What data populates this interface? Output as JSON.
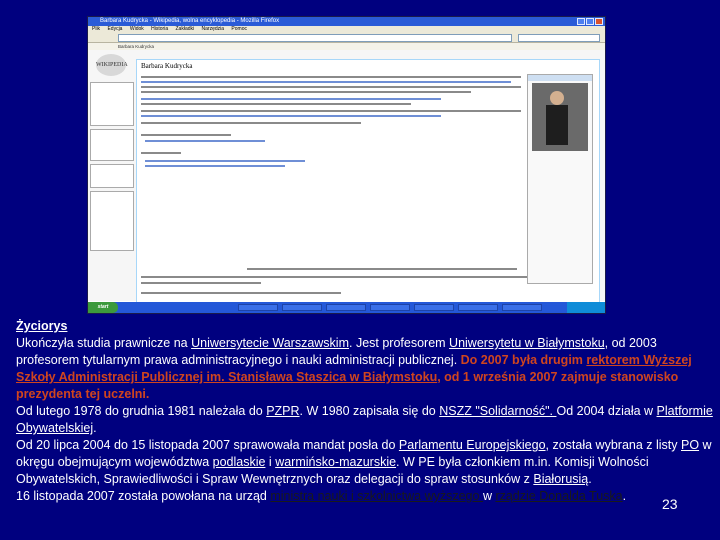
{
  "window": {
    "title": "Barbara Kudrycka - Wikipedia, wolna encyklopedia - Mozilla Firefox",
    "menu": [
      "Plik",
      "Edycja",
      "Widok",
      "Historia",
      "Zakładki",
      "Narzędzia",
      "Pomoc"
    ],
    "tab_label": "Barbara Kudrycka",
    "start_label": "start"
  },
  "wiki": {
    "logo_text": "WIKIPEDIA",
    "article_title": "Barbara Kudrycka"
  },
  "slide": {
    "heading": "Życiorys",
    "p1": [
      "Ukończyła studia prawnicze na ",
      "Uniwersytecie Warszawskim",
      ". Jest profesorem ",
      "Uniwersytetu w Białymstoku",
      ", od 2003 profesorem tytularnym prawa administracyjnego i nauki administracji publicznej. ",
      "Do 2007 była drugim ",
      "rektorem Wyższej Szkoły Administracji Publicznej im. Stanisława Staszica w Białymstoku",
      ", od 1 września 2007 zajmuje stanowisko prezydenta tej uczelni."
    ],
    "p2": [
      "Od lutego 1978 do grudnia 1981 należała do ",
      "PZPR",
      ". W 1980 zapisała się do ",
      "NSZZ \"Solidarność\". ",
      "Od 2004 działa w ",
      "Platformie Obywatelskiej",
      "."
    ],
    "p3": [
      "Od 20 lipca 2004 do 15 listopada 2007 sprawowała mandat posła do ",
      "Parlamentu Europejskiego",
      ", została wybrana z listy ",
      "PO",
      " w okręgu obejmującym województwa ",
      "podlaskie",
      " i ",
      "warmińsko-mazurskie",
      ". W PE była członkiem m.in. Komisji Wolności Obywatelskich, Sprawiedliwości i Spraw Wewnętrznych oraz delegacji do spraw stosunków z ",
      "Białorusią",
      "."
    ],
    "p4": [
      "16 listopada 2007 została powołana na urząd ",
      "ministra nauki i szkolnictwa wyższego ",
      "w ",
      "rządzie Donalda Tuska",
      "."
    ],
    "page_number": "23"
  }
}
